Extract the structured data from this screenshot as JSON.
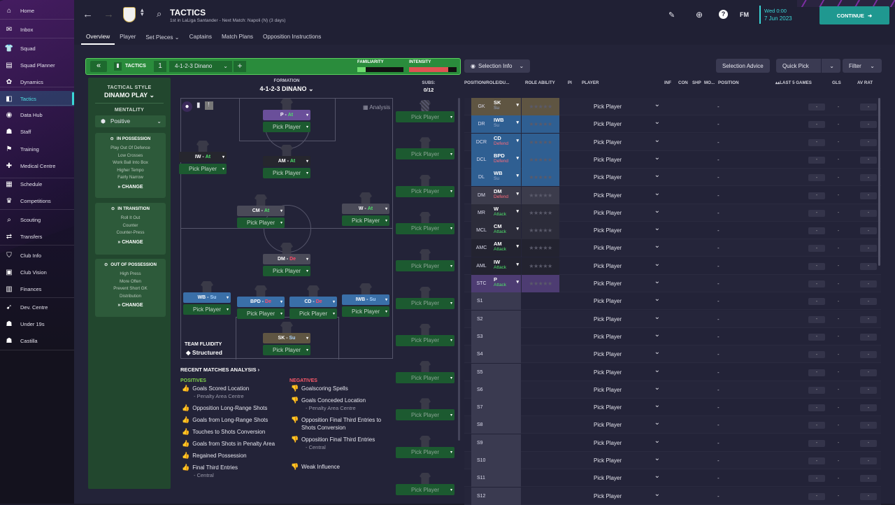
{
  "sidebar": {
    "items": [
      {
        "label": "Home",
        "icon": "home-icon",
        "glyph": "⌂"
      },
      {
        "label": "Inbox",
        "icon": "inbox-icon",
        "glyph": "✉"
      },
      {
        "label": "Squad",
        "icon": "shirt-icon",
        "glyph": "👕"
      },
      {
        "label": "Squad Planner",
        "icon": "planner-icon",
        "glyph": "▤"
      },
      {
        "label": "Dynamics",
        "icon": "dynamics-icon",
        "glyph": "✿"
      },
      {
        "label": "Tactics",
        "icon": "tactics-icon",
        "glyph": "◧"
      },
      {
        "label": "Data Hub",
        "icon": "data-hub-icon",
        "glyph": "◉"
      },
      {
        "label": "Staff",
        "icon": "staff-icon",
        "glyph": "☗"
      },
      {
        "label": "Training",
        "icon": "training-icon",
        "glyph": "⚑"
      },
      {
        "label": "Medical Centre",
        "icon": "medical-icon",
        "glyph": "✚"
      },
      {
        "label": "Schedule",
        "icon": "schedule-icon",
        "glyph": "▦"
      },
      {
        "label": "Competitions",
        "icon": "trophy-icon",
        "glyph": "♛"
      },
      {
        "label": "Scouting",
        "icon": "scouting-icon",
        "glyph": "⌕"
      },
      {
        "label": "Transfers",
        "icon": "transfers-icon",
        "glyph": "⇄"
      },
      {
        "label": "Club Info",
        "icon": "shield-icon",
        "glyph": "⛉"
      },
      {
        "label": "Club Vision",
        "icon": "vision-icon",
        "glyph": "▣"
      },
      {
        "label": "Finances",
        "icon": "finances-icon",
        "glyph": "▥"
      },
      {
        "label": "Dev. Centre",
        "icon": "dev-centre-icon",
        "glyph": "➹"
      },
      {
        "label": "Under 19s",
        "icon": "under19-icon",
        "glyph": "☗"
      },
      {
        "label": "Castilla",
        "icon": "castilla-icon",
        "glyph": "☗"
      }
    ]
  },
  "header": {
    "title": "TACTICS",
    "subtitle": "1st in LaLiga Santander - Next Match: Napoli (N) (3 days)",
    "date_line1": "Wed 0:00",
    "date_line2": "7 Jun 2023",
    "continue": "CONTINUE",
    "fm": "FM"
  },
  "tabs": [
    "Overview",
    "Player",
    "Set Pieces ⌄",
    "Captains",
    "Match Plans",
    "Opposition Instructions"
  ],
  "tacbar": {
    "label": "TACTICS",
    "number": "1",
    "name": "4-1-2-3 Dinano",
    "familiarity": "FAMILIARITY",
    "intensity": "INTENSITY"
  },
  "left": {
    "style_label": "TACTICAL STYLE",
    "style_value": "DINAMO PLAY",
    "mentality_label": "MENTALITY",
    "mentality_value": "Positive",
    "possession": {
      "title": "IN POSSESSION",
      "lines": [
        "Play Out Of Defence",
        "Low Crosses",
        "Work Ball Into Box",
        "Higher Tempo",
        "Fairly Narrow"
      ]
    },
    "transition": {
      "title": "IN TRANSITION",
      "lines": [
        "Roll It Out",
        "Counter",
        "Counter-Press"
      ]
    },
    "out": {
      "title": "OUT OF POSSESSION",
      "lines": [
        "High Press",
        "More Often",
        "Prevent Short GK",
        "Distribution"
      ]
    },
    "change": "CHANGE"
  },
  "formation": {
    "label": "FORMATION",
    "value": "4-1-2-3 DINANO",
    "subs_label": "SUBS:",
    "subs_value": "0/12",
    "analysis": "Analysis",
    "fluidity_label": "TEAM FLUIDITY",
    "fluidity_value": "Structured",
    "pick": "Pick Player"
  },
  "pitch_players": [
    {
      "role": "P",
      "duty": "At",
      "color": "#6a4f9a"
    },
    {
      "role": "IW",
      "duty": "At",
      "color": "#26262e"
    },
    {
      "role": "AM",
      "duty": "At",
      "color": "#26262e"
    },
    {
      "role": "CM",
      "duty": "At",
      "color": "#4a4a58"
    },
    {
      "role": "W",
      "duty": "At",
      "color": "#4a4a58"
    },
    {
      "role": "DM",
      "duty": "De",
      "color": "#4a4a58"
    },
    {
      "role": "WB",
      "duty": "Su",
      "color": "#3a6fa8"
    },
    {
      "role": "BPD",
      "duty": "De",
      "color": "#3a6fa8"
    },
    {
      "role": "CD",
      "duty": "De",
      "color": "#3a6fa8"
    },
    {
      "role": "IWB",
      "duty": "Su",
      "color": "#3a6fa8"
    },
    {
      "role": "SK",
      "duty": "Su",
      "color": "#5f5542"
    }
  ],
  "analysis": {
    "title": "RECENT MATCHES ANALYSIS ›",
    "pos_label": "POSITIVES",
    "neg_label": "NEGATIVES",
    "positives": [
      {
        "t": "Goals Scored Location",
        "s": "- Penalty Area Centre"
      },
      {
        "t": "Opposition Long-Range Shots",
        "s": ""
      },
      {
        "t": "Goals from Long-Range Shots",
        "s": ""
      },
      {
        "t": "Touches to Shots Conversion",
        "s": ""
      },
      {
        "t": "Goals from Shots in Penalty Area",
        "s": ""
      },
      {
        "t": "Regained Possession",
        "s": ""
      },
      {
        "t": "Final Third Entries",
        "s": "- Central"
      }
    ],
    "negatives": [
      {
        "t": "Goalscoring Spells",
        "s": ""
      },
      {
        "t": "Goals Conceded Location",
        "s": "- Penalty Area Centre"
      },
      {
        "t": "Opposition Final Third Entries to Shots Conversion",
        "s": ""
      },
      {
        "t": "Opposition Final Third Entries",
        "s": "- Central"
      },
      {
        "t": "Weak Influence",
        "s": ""
      }
    ]
  },
  "selection": {
    "info_btn": "Selection Info",
    "advice_btn": "Selection Advice",
    "quick_btn": "Quick Pick",
    "filter_btn": "Filter",
    "headers": [
      "POSITION/ROLE/DU...",
      "ROLE ABILITY",
      "PI",
      "PLAYER",
      "INF",
      "CON",
      "SHP",
      "MO...",
      "POSITION",
      "▴▴LAST 5 GAMES",
      "GLS",
      "AV RAT"
    ],
    "rows": [
      {
        "pos": "GK",
        "role": "SK",
        "duty": "Su",
        "color": "#5f5542"
      },
      {
        "pos": "DR",
        "role": "IWB",
        "duty": "Su",
        "color": "#2f5f92"
      },
      {
        "pos": "DCR",
        "role": "CD",
        "duty": "Defend",
        "color": "#2f5f92"
      },
      {
        "pos": "DCL",
        "role": "BPD",
        "duty": "Defend",
        "color": "#2f5f92"
      },
      {
        "pos": "DL",
        "role": "WB",
        "duty": "Su",
        "color": "#2f5f92"
      },
      {
        "pos": "DM",
        "role": "DM",
        "duty": "Defend",
        "color": "#3c3c4c"
      },
      {
        "pos": "MR",
        "role": "W",
        "duty": "Attack",
        "color": "#2c2c3a"
      },
      {
        "pos": "MCL",
        "role": "CM",
        "duty": "Attack",
        "color": "#2c2c3a"
      },
      {
        "pos": "AMC",
        "role": "AM",
        "duty": "Attack",
        "color": "#232330"
      },
      {
        "pos": "AML",
        "role": "IW",
        "duty": "Attack",
        "color": "#232330"
      },
      {
        "pos": "STC",
        "role": "P",
        "duty": "Attack",
        "color": "#4d3c72"
      },
      {
        "pos": "S1"
      },
      {
        "pos": "S2"
      },
      {
        "pos": "S3"
      },
      {
        "pos": "S4"
      },
      {
        "pos": "S5"
      },
      {
        "pos": "S6"
      },
      {
        "pos": "S7"
      },
      {
        "pos": "S8"
      },
      {
        "pos": "S9"
      },
      {
        "pos": "S10"
      },
      {
        "pos": "S11"
      },
      {
        "pos": "S12"
      }
    ],
    "pick": "Pick Player",
    "dash": "-"
  }
}
